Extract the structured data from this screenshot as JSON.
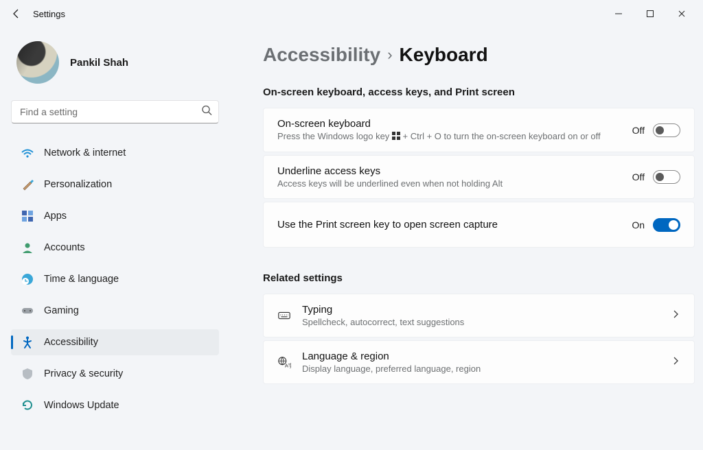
{
  "window": {
    "title": "Settings"
  },
  "user": {
    "name": "Pankil Shah"
  },
  "search": {
    "placeholder": "Find a setting"
  },
  "sidebar": {
    "items": [
      {
        "label": "Network & internet"
      },
      {
        "label": "Personalization"
      },
      {
        "label": "Apps"
      },
      {
        "label": "Accounts"
      },
      {
        "label": "Time & language"
      },
      {
        "label": "Gaming"
      },
      {
        "label": "Accessibility"
      },
      {
        "label": "Privacy & security"
      },
      {
        "label": "Windows Update"
      }
    ]
  },
  "breadcrumb": {
    "parent": "Accessibility",
    "current": "Keyboard"
  },
  "sections": {
    "s1_title": "On-screen keyboard, access keys, and Print screen",
    "related_title": "Related settings"
  },
  "settings": {
    "osk": {
      "title": "On-screen keyboard",
      "sub_a": "Press the Windows logo key ",
      "sub_b": " + Ctrl + O to turn the on-screen keyboard on or off",
      "state": "Off"
    },
    "underline": {
      "title": "Underline access keys",
      "sub": "Access keys will be underlined even when not holding Alt",
      "state": "Off"
    },
    "printscreen": {
      "title": "Use the Print screen key to open screen capture",
      "state": "On"
    }
  },
  "related": {
    "typing": {
      "title": "Typing",
      "sub": "Spellcheck, autocorrect, text suggestions"
    },
    "lang": {
      "title": "Language & region",
      "sub": "Display language, preferred language, region"
    }
  }
}
